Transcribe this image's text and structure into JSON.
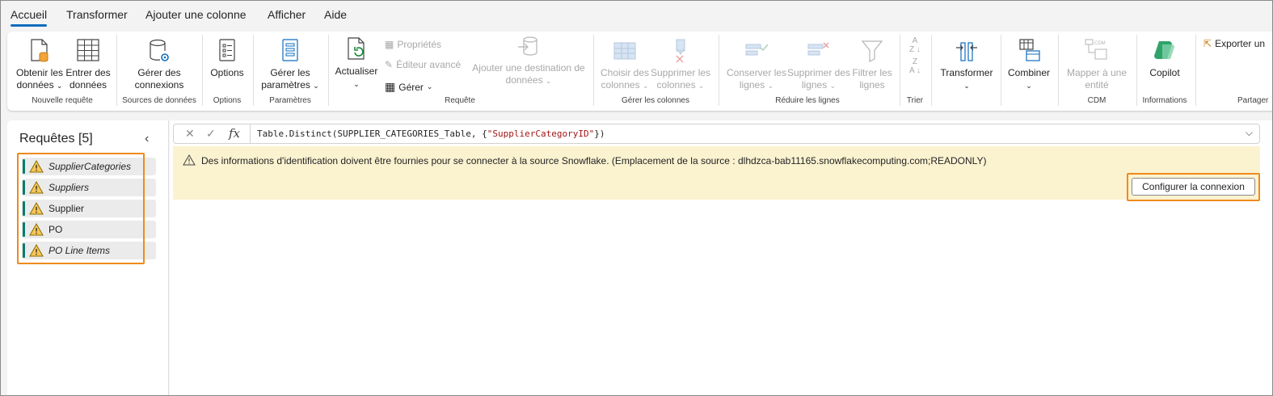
{
  "menu": {
    "tabs": [
      "Accueil",
      "Transformer",
      "Ajouter une colonne",
      "Afficher",
      "Aide"
    ],
    "active": "Accueil"
  },
  "ribbon": {
    "get_data": [
      "Obtenir les",
      "données"
    ],
    "enter_data": [
      "Entrer des",
      "données"
    ],
    "group_new_query": "Nouvelle requête",
    "manage_connections": [
      "Gérer des",
      "connexions"
    ],
    "group_data_sources": "Sources de données",
    "options": "Options",
    "group_options": "Options",
    "manage_params": [
      "Gérer les",
      "paramètres"
    ],
    "group_params": "Paramètres",
    "refresh": "Actualiser",
    "properties": "Propriétés",
    "advanced_editor": "Éditeur avancé",
    "manage": "Gérer",
    "add_destination": [
      "Ajouter une destination de",
      "données"
    ],
    "group_query": "Requête",
    "choose_columns": [
      "Choisir des",
      "colonnes"
    ],
    "remove_columns": [
      "Supprimer les",
      "colonnes"
    ],
    "group_manage_columns": "Gérer les colonnes",
    "keep_rows": [
      "Conserver les",
      "lignes"
    ],
    "remove_rows": [
      "Supprimer des",
      "lignes"
    ],
    "filter_rows": [
      "Filtrer les",
      "lignes"
    ],
    "group_reduce_rows": "Réduire les lignes",
    "group_sort": "Trier",
    "transform": "Transformer",
    "combine": "Combiner",
    "map_entity": [
      "Mapper à une",
      "entité"
    ],
    "group_cdm": "CDM",
    "copilot": "Copilot",
    "group_info": "Informations",
    "export": "Exporter un",
    "group_share": "Partager",
    "cdm_badge": "CDM"
  },
  "queries": {
    "title": "Requêtes [5]",
    "items": [
      {
        "label": "SupplierCategories",
        "italic": true
      },
      {
        "label": "Suppliers",
        "italic": true
      },
      {
        "label": "Supplier",
        "italic": false
      },
      {
        "label": "PO",
        "italic": false
      },
      {
        "label": "PO Line Items",
        "italic": true
      }
    ]
  },
  "formula": {
    "prefix": "Table.Distinct(SUPPLIER_CATEGORIES_Table, {",
    "string": "\"SupplierCategoryID\"",
    "suffix": "})",
    "fx": "fx"
  },
  "warning": {
    "message": "Des informations d'identification doivent être fournies pour se connecter à la source Snowflake. (Emplacement de la source : dlhdzca-bab11165.snowflakecomputing.com;READONLY)",
    "button": "Configurer la connexion"
  },
  "colors": {
    "accent": "#0f6cbd",
    "highlight": "#f08a1c",
    "warning_bg": "#fbf2d0",
    "query_bar": "#0e7a6b"
  }
}
